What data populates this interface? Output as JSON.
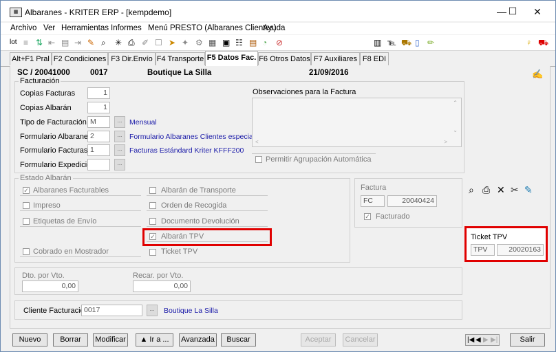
{
  "window": {
    "title": "Albaranes - KRITER ERP - [kempdemo]",
    "app_icon": "erp-app-icon",
    "minimize": "—",
    "maximize": "☐",
    "close": "✕"
  },
  "menu": [
    "Archivo",
    "Ver",
    "Herramientas",
    "Informes",
    "Menú PRESTO (Albaranes Clientes)",
    "Ayuda"
  ],
  "toolbar": {
    "lot_label": "lot",
    "icons": [
      "lot-icon",
      "list-icon",
      "sort-icon",
      "first-icon",
      "prev-icon",
      "next-icon",
      "preview-icon",
      "asterisk-icon",
      "print-icon",
      "approve-icon",
      "copy-icon",
      "tools-icon",
      "export-icon",
      "calc-icon",
      "grid-icon",
      "doc-icon",
      "gauge-icon",
      "settings-icon"
    ],
    "right_icons": [
      "bulb-icon",
      "car-icon"
    ]
  },
  "tabs": [
    "Alt+F1 Pral",
    "F2 Condiciones",
    "F3 Dir.Envío",
    "F4 Transporte",
    "F5 Datos Fac.",
    "F6 Otros Datos",
    "F7 Auxiliares",
    "F8 EDI"
  ],
  "active_tab": "F5 Datos Fac.",
  "header": {
    "doc_code": "SC / 20041000",
    "client_code": "0017",
    "client_name": "Boutique La Silla",
    "date": "21/09/2016"
  },
  "facturacion": {
    "section_label": "Facturación",
    "copias_facturas_label": "Copias Facturas",
    "copias_facturas_value": "1",
    "copias_albaran_label": "Copias Albarán",
    "copias_albaran_value": "1",
    "tipo_facturacion_label": "Tipo de Facturación",
    "tipo_facturacion_value": "M",
    "tipo_facturacion_desc": "Mensual",
    "form_albaranes_label": "Formulario Albaranes",
    "form_albaranes_value": "2",
    "form_albaranes_desc": "Formulario Albaranes Clientes especial",
    "form_facturas_label": "Formulario Facturas",
    "form_facturas_value": "1",
    "form_facturas_desc": "Facturas Estándard Kriter KFFF200",
    "form_expediciones_label": "Formulario Expediciones",
    "form_expediciones_value": "",
    "dots": "..."
  },
  "observaciones": {
    "label": "Observaciones para la Factura",
    "value": "",
    "permitir_label": "Permitir Agrupación Automática"
  },
  "estado": {
    "label": "Estado  Albarán",
    "left": [
      "Albaranes Facturables",
      "Impreso",
      "Etiquetas de Envío",
      "Cobrado en Mostrador"
    ],
    "left_checked": [
      true,
      false,
      false,
      false
    ],
    "right": [
      "Albarán de Transporte",
      "Orden de Recogida",
      "Documento Devolución",
      "Albarán TPV",
      "Ticket TPV"
    ],
    "right_checked": [
      false,
      false,
      false,
      true,
      false
    ]
  },
  "factura": {
    "label": "Factura",
    "serie": "FC",
    "numero": "20040424",
    "facturado_label": "Facturado",
    "facturado_checked": true
  },
  "action_icons": [
    "preview-icon",
    "print-icon",
    "delete-icon",
    "cut-icon",
    "paint-icon"
  ],
  "ticket_tpv": {
    "label": "Ticket TPV",
    "serie": "TPV",
    "numero": "20020163"
  },
  "dto": {
    "dto_label": "Dto. por Vto.",
    "dto_value": "0,00",
    "recar_label": "Recar. por Vto.",
    "recar_value": "0,00"
  },
  "cliente_facturacion": {
    "label": "Cliente Facturación",
    "code": "0017",
    "name": "Boutique La Silla"
  },
  "buttons": {
    "nuevo": "Nuevo",
    "borrar": "Borrar",
    "modificar": "Modificar",
    "ira": "▲ Ir a ...",
    "avanzada": "Avanzada",
    "buscar": "Buscar",
    "aceptar": "Aceptar",
    "cancelar": "Cancelar",
    "salir": "Salir",
    "nav": [
      "|◀",
      "◀",
      "▶",
      "▶|"
    ]
  },
  "colors": {
    "highlight": "#e00000",
    "link": "#1a1aa8"
  }
}
